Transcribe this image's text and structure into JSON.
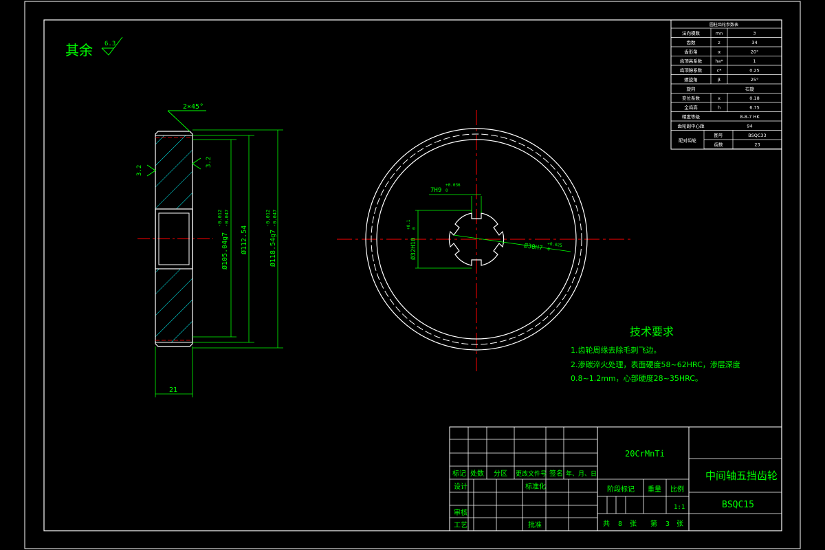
{
  "header": {
    "roughness_label": "其余",
    "roughness_value": "6.3"
  },
  "side_view": {
    "chamfer": "2×45°",
    "roughness_left": "3.2",
    "roughness_right": "3.2",
    "dim_inner": "Ø105.04g7",
    "dim_inner_tol_upper": "-0.012",
    "dim_inner_tol_lower": "-0.047",
    "dim_mid": "Ø112.54",
    "dim_outer": "Ø118.54g7",
    "dim_outer_tol_upper": "-0.012",
    "dim_outer_tol_lower": "-0.047",
    "width": "21"
  },
  "front_view": {
    "slot_label": "7H9",
    "slot_tol_upper": "+0.036",
    "slot_tol_lower": "0",
    "bore_label": "Ø32H10",
    "bore_tol_upper": "+0.1",
    "bore_tol_lower": "0",
    "spline_label": "Ø38H7",
    "spline_tol_upper": "+0.025",
    "spline_tol_lower": "0"
  },
  "tech_requirements": {
    "title": "技术要求",
    "items": [
      "1.齿轮周缘去除毛刺飞边。",
      "2.渗碳淬火处理，表面硬度58~62HRC，渗层深度",
      "0.8~1.2mm，心部硬度28~35HRC。"
    ]
  },
  "param_table": {
    "title": "圆柱齿轮参数表",
    "rows": [
      {
        "name": "法向模数",
        "sym": "mn",
        "val": "3"
      },
      {
        "name": "齿数",
        "sym": "z",
        "val": "34"
      },
      {
        "name": "齿形角",
        "sym": "α",
        "val": "20°"
      },
      {
        "name": "齿顶高系数",
        "sym": "ha*",
        "val": "1"
      },
      {
        "name": "齿顶隙系数",
        "sym": "c*",
        "val": "0.25"
      },
      {
        "name": "螺旋角",
        "sym": "β",
        "val": "25°"
      },
      {
        "name": "旋向",
        "sym": "",
        "val": "右旋"
      },
      {
        "name": "变位系数",
        "sym": "x",
        "val": "0.18"
      },
      {
        "name": "全齿高",
        "sym": "h",
        "val": "6.75"
      },
      {
        "name": "精度等级",
        "sym": "",
        "val": "8-8-7 HK"
      },
      {
        "name": "齿轮副中心距",
        "sym": "",
        "val": "94"
      }
    ],
    "pair_label": "配对齿轮",
    "pair_rows": [
      {
        "name": "图号",
        "val": "BSQC33"
      },
      {
        "name": "齿数",
        "val": "23"
      }
    ]
  },
  "title_block": {
    "material": "20CrMnTi",
    "part_name": "中间轴五挡齿轮",
    "drawing_no": "BSQC15",
    "rev_headers": [
      "标记",
      "处数",
      "分区",
      "更改文件号",
      "签名",
      "年、月、日"
    ],
    "design": "设计",
    "standardize": "标准化",
    "review": "审核",
    "process": "工艺",
    "approve": "批准",
    "stage_mark": "阶段标记",
    "weight": "重量",
    "scale": "比例",
    "scale_value": "1:1",
    "sheet_total_prefix": "共",
    "sheet_total": "8",
    "sheet_unit1": "张",
    "sheet_no_prefix": "第",
    "sheet_no": "3",
    "sheet_unit2": "张"
  }
}
